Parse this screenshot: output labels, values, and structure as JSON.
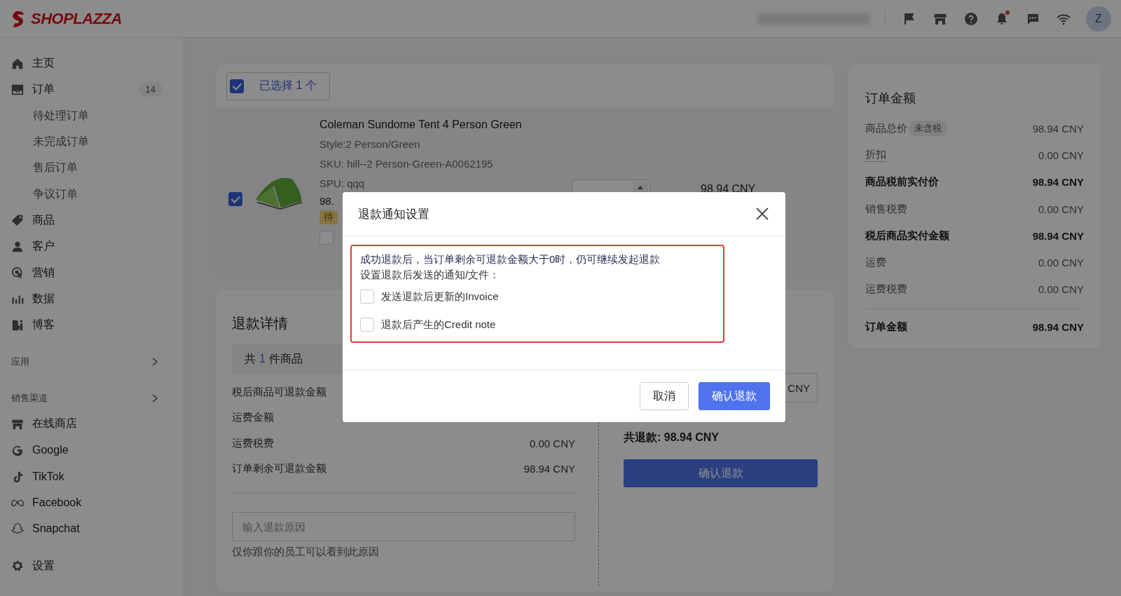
{
  "topbar": {
    "logo": "SHOPLAZZA",
    "avatar": "Z",
    "notification_dot": true
  },
  "sidebar": {
    "groups": [
      {
        "items": [
          {
            "label": "主页"
          },
          {
            "label": "订单",
            "badge": "14",
            "children": [
              {
                "label": "待处理订单"
              },
              {
                "label": "未完成订单"
              },
              {
                "label": "售后订单"
              },
              {
                "label": "争议订单"
              }
            ]
          },
          {
            "label": "商品"
          },
          {
            "label": "客户"
          },
          {
            "label": "营销"
          },
          {
            "label": "数据"
          },
          {
            "label": "博客"
          }
        ]
      },
      {
        "heading": "应用"
      },
      {
        "heading": "销售渠道",
        "items": [
          {
            "label": "在线商店"
          },
          {
            "label": "Google"
          },
          {
            "label": "TikTok"
          },
          {
            "label": "Facebook"
          },
          {
            "label": "Snapchat"
          }
        ]
      },
      {
        "items": [
          {
            "label": "设置"
          }
        ]
      }
    ]
  },
  "selection": {
    "label": "已选择 1 个",
    "checked": true
  },
  "product": {
    "checked": true,
    "name": "Coleman Sundome Tent 4 Person Green",
    "details": [
      "Style:2 Person/Green",
      "SKU: hill--2 Person-Green-A0062195",
      "SPU: qqq"
    ],
    "price_partial": "98.",
    "status_partial": "待",
    "restock_checked": false,
    "total": "98.94 CNY"
  },
  "refund_details": {
    "title": "退款详情",
    "count": {
      "prefix": "共",
      "number": "1",
      "suffix": "件商品"
    },
    "rows": [
      {
        "label": "税后商品可退款金额"
      },
      {
        "label": "运费金额"
      },
      {
        "label": "运费税费",
        "value": "0.00 CNY"
      },
      {
        "label": "订单剩余可退款金额",
        "value": "98.94 CNY"
      }
    ],
    "reason": {
      "placeholder": "输入退款原因"
    },
    "reason_help": "仅你跟你的员工可以看到此原因",
    "amount_field_partial": "CNY",
    "total": "共退款: 98.94 CNY",
    "button": "确认退款"
  },
  "order_amount": {
    "title": "订单金额",
    "rows": [
      {
        "label": "商品总价",
        "badge": "未含税",
        "value": "98.94 CNY",
        "bold": false
      },
      {
        "label": "折扣",
        "value": "0.00 CNY",
        "bold": false,
        "dotted": true
      },
      {
        "label": "商品税前实付价",
        "value": "98.94 CNY",
        "bold": true
      },
      {
        "label": "销售税费",
        "value": "0.00 CNY",
        "bold": false
      },
      {
        "label": "税后商品实付金额",
        "value": "98.94 CNY",
        "bold": true
      },
      {
        "label": "运费",
        "value": "0.00 CNY",
        "bold": false
      },
      {
        "label": "运费税费",
        "value": "0.00 CNY",
        "bold": false
      }
    ],
    "total": {
      "label": "订单金额",
      "value": "98.94 CNY"
    }
  },
  "dialog": {
    "title": "退款通知设置",
    "notice": "成功退款后，当订单剩余可退款金额大于0时，仍可继续发起退款",
    "prompt": "设置退款后发送的通知/文件：",
    "options": [
      {
        "label": "发送退款后更新的Invoice",
        "checked": false
      },
      {
        "label": "退款后产生的Credit note",
        "checked": false
      }
    ],
    "buttons": [
      {
        "label": "取消",
        "kind": "secondary"
      },
      {
        "label": "确认退款",
        "kind": "primary"
      }
    ]
  }
}
